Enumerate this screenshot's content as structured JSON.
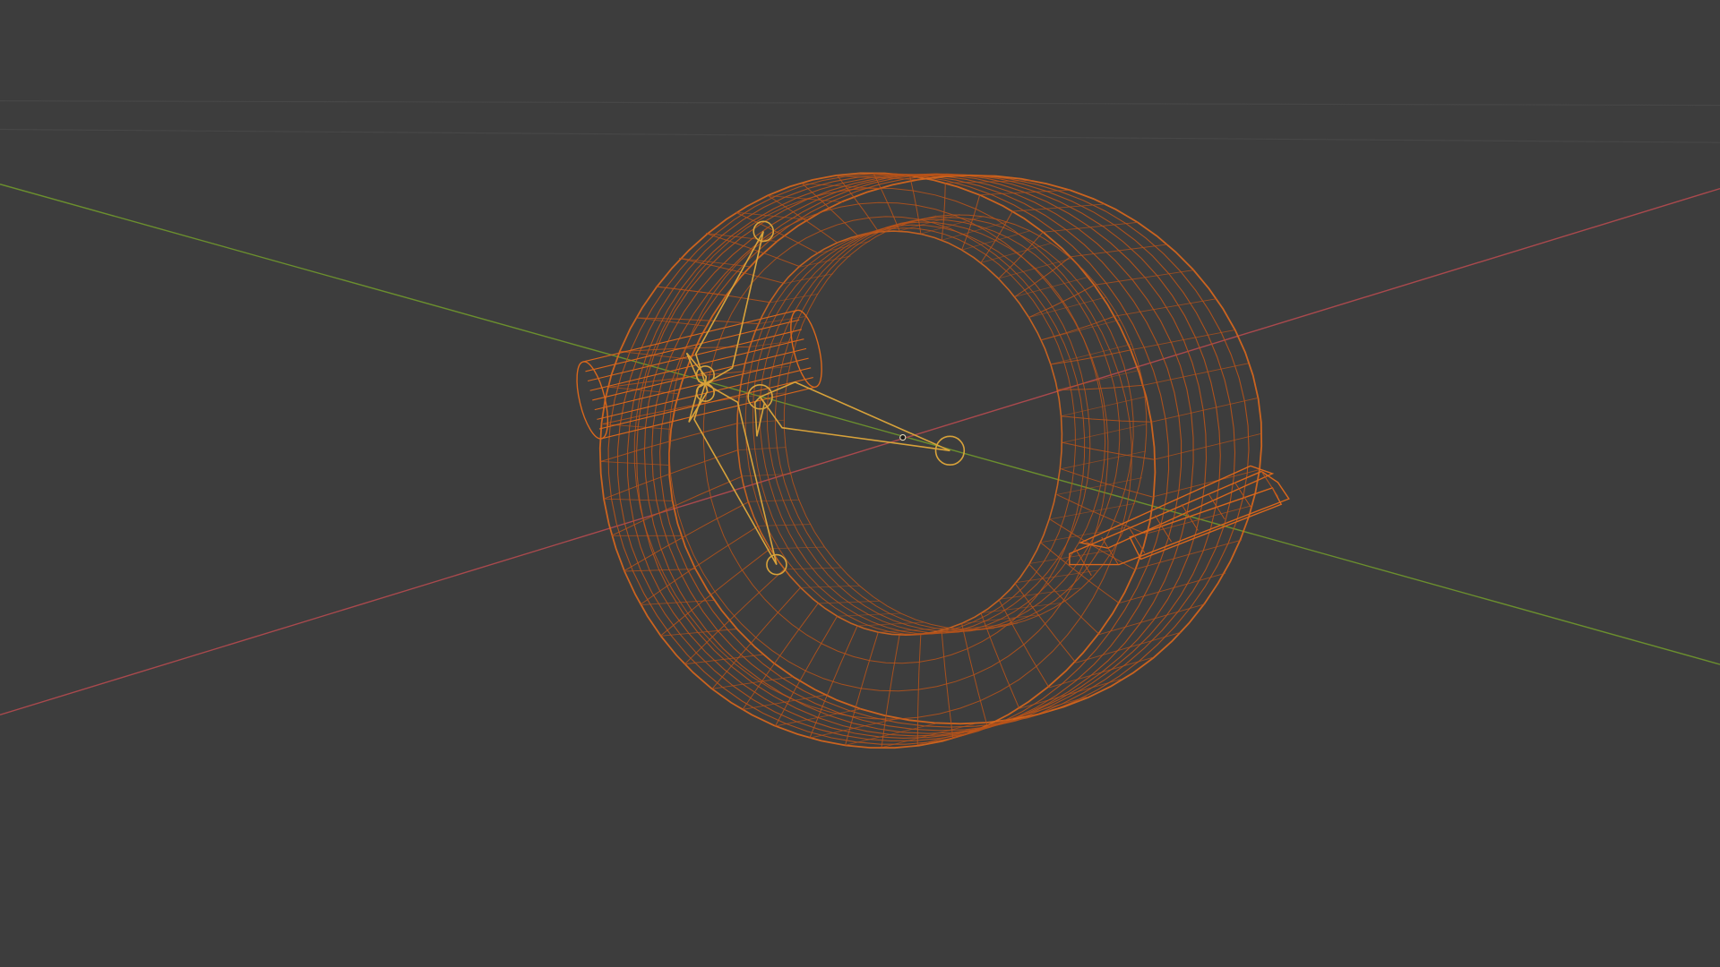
{
  "viewport": {
    "mode": "wireframe",
    "background_color": "#3d3d3d",
    "grid_color": "#474747"
  },
  "axes": {
    "x_axis": {
      "name": "X",
      "color": "#a9494d"
    },
    "y_axis": {
      "name": "Y",
      "color": "#6b8f2e"
    }
  },
  "object": {
    "type": "mesh",
    "shape": "band",
    "selected": true,
    "wire_color": "#d9671c",
    "wire_color_dim": "#b8531a",
    "active_origin_color": "#f0e3c0"
  },
  "armature": {
    "selected": true,
    "wire_color": "#d8a23a",
    "bone_count": 6
  }
}
